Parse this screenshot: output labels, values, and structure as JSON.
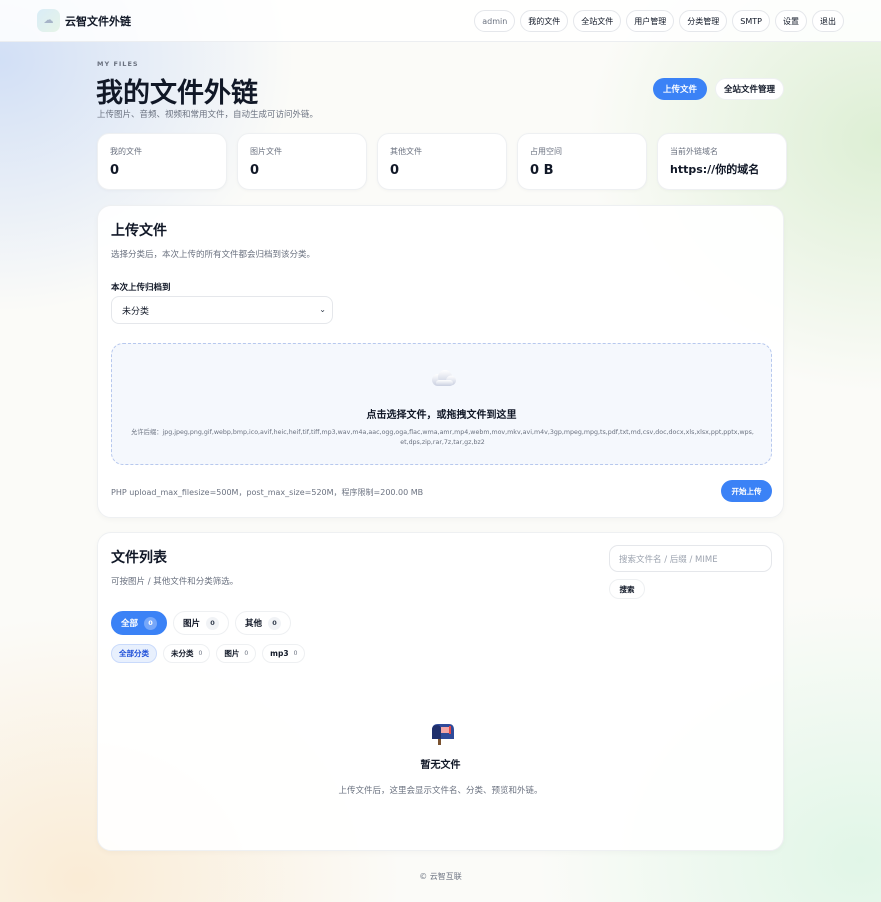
{
  "brand": {
    "name": "云智文件外链",
    "logo_icon": "cloud-logo-icon"
  },
  "nav": {
    "items": [
      "admin",
      "我的文件",
      "全站文件",
      "用户管理",
      "分类管理",
      "SMTP",
      "设置",
      "退出"
    ]
  },
  "header": {
    "eyebrow": "MY FILES",
    "title": "我的文件外链",
    "subtitle": "上传图片、音频、视频和常用文件，自动生成可访问外链。",
    "upload_button": "上传文件",
    "all_files_button": "全站文件管理"
  },
  "stats": [
    {
      "label": "我的文件",
      "value": "0"
    },
    {
      "label": "图片文件",
      "value": "0"
    },
    {
      "label": "其他文件",
      "value": "0"
    },
    {
      "label": "占用空间",
      "value": "0 B"
    },
    {
      "label": "当前外链域名",
      "value": "https://你的域名"
    }
  ],
  "upload": {
    "title": "上传文件",
    "subtitle": "选择分类后，本次上传的所有文件都会归档到该分类。",
    "category_label": "本次上传归档到",
    "category_value": "未分类",
    "dropzone_title": "点击选择文件，或拖拽文件到这里",
    "allowed_types": "允许后缀：jpg,jpeg,png,gif,webp,bmp,ico,avif,heic,heif,tif,tiff,mp3,wav,m4a,aac,ogg,oga,flac,wma,amr,mp4,webm,mov,mkv,avi,m4v,3gp,mpeg,mpg,ts,pdf,txt,md,csv,doc,docx,xls,xlsx,ppt,pptx,wps,et,dps,zip,rar,7z,tar,gz,bz2",
    "limits": "PHP upload_max_filesize=500M，post_max_size=520M，程序限制=200.00 MB",
    "start_button": "开始上传"
  },
  "file_list": {
    "title": "文件列表",
    "subtitle": "可按图片 / 其他文件和分类筛选。",
    "search_placeholder": "搜索文件名 / 后缀 / MIME",
    "search_button": "搜索",
    "type_tabs": [
      {
        "label": "全部",
        "count": "0"
      },
      {
        "label": "图片",
        "count": "0"
      },
      {
        "label": "其他",
        "count": "0"
      }
    ],
    "category_tabs": [
      {
        "label": "全部分类",
        "count": ""
      },
      {
        "label": "未分类",
        "count": "0"
      },
      {
        "label": "图片",
        "count": "0"
      },
      {
        "label": "mp3",
        "count": "0"
      }
    ],
    "empty_title": "暂无文件",
    "empty_subtitle": "上传文件后，这里会显示文件名、分类、预览和外链。",
    "empty_icon": "mailbox-icon"
  },
  "footer": {
    "text": "© 云智互联"
  },
  "colors": {
    "accent": "#3b82f6"
  }
}
